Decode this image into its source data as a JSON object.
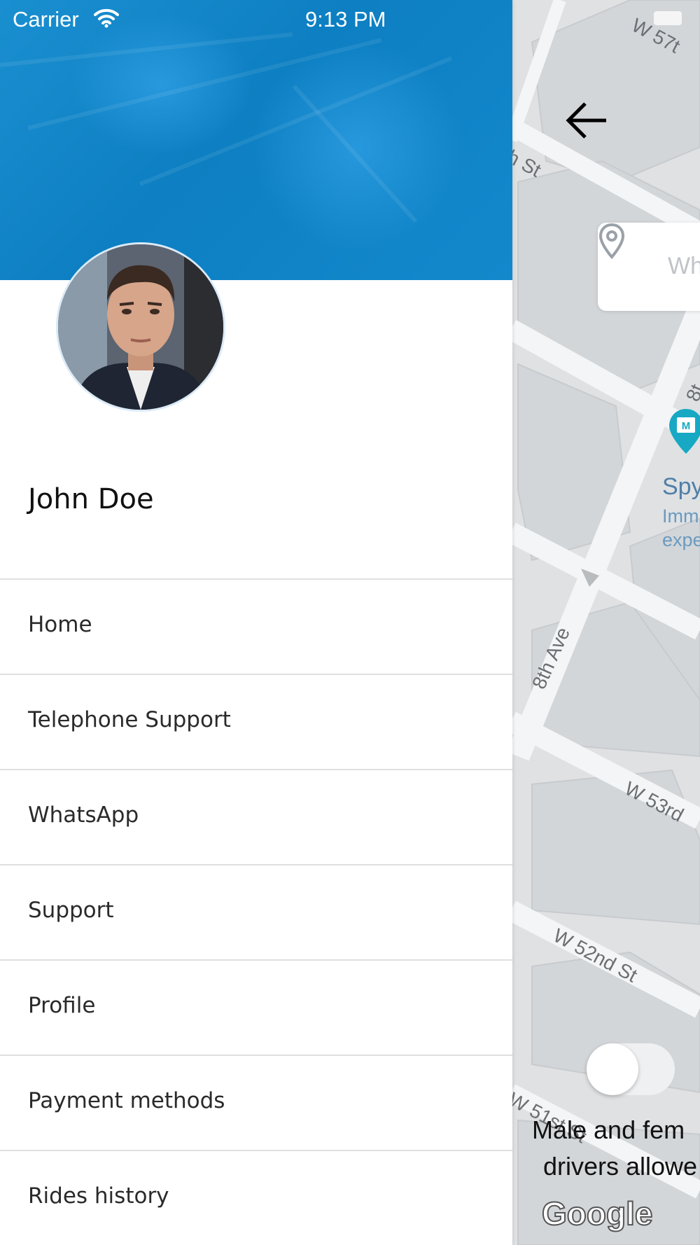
{
  "status_bar": {
    "carrier": "Carrier",
    "time": "9:13 PM"
  },
  "drawer": {
    "user_name": "John Doe",
    "menu": [
      {
        "label": "Home"
      },
      {
        "label": "Telephone Support"
      },
      {
        "label": "WhatsApp"
      },
      {
        "label": "Support"
      },
      {
        "label": "Profile"
      },
      {
        "label": "Payment methods"
      },
      {
        "label": "Rides history"
      }
    ]
  },
  "map": {
    "search_placeholder": "Wh",
    "streets": {
      "w57": "W 57t",
      "th_st": "h St",
      "eighth_ave": "8th Ave",
      "eighth_top": "8t",
      "w53": "W 53rd",
      "w52": "W 52nd St",
      "w51": "W 51st St"
    },
    "poi": {
      "title": "Spy",
      "line1": "Imm",
      "line2": "expe",
      "icon": "museum-icon"
    },
    "toggle_caption_line1": "Male and fem",
    "toggle_caption_line2": "drivers allowe",
    "toggle_on": false,
    "attribution": "Google"
  },
  "colors": {
    "header_blue": "#0d7fc2",
    "map_bg": "#dfe1e3",
    "poi_teal": "#17a9c4"
  }
}
